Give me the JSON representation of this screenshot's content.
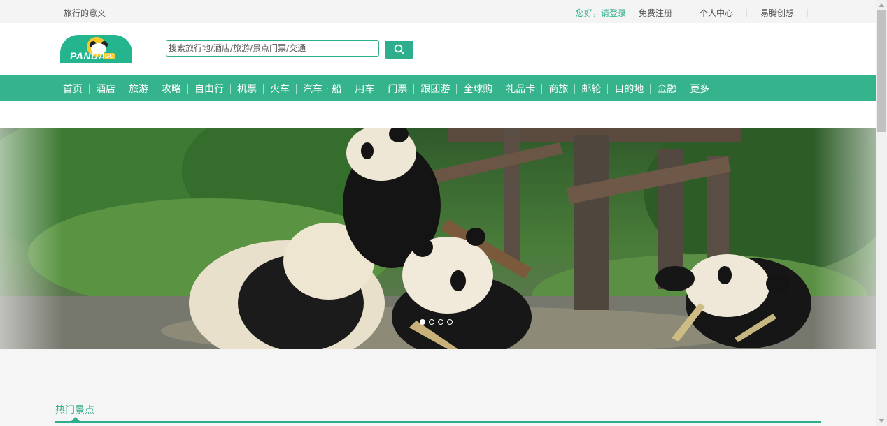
{
  "topbar": {
    "slogan": "旅行的意义",
    "login": "您好，请登录",
    "register": "免费注册",
    "personal_center": "个人中心",
    "yiteng": "易腾创想"
  },
  "logo": {
    "text": "PANDA",
    "badge": "GO"
  },
  "search": {
    "placeholder": "搜索旅行地/酒店/旅游/景点门票/交通",
    "button_icon": "search-icon"
  },
  "nav": {
    "items": [
      "首页",
      "酒店",
      "旅游",
      "攻略",
      "自由行",
      "机票",
      "火车",
      "汽车 · 船",
      "用车",
      "门票",
      "跟团游",
      "全球购",
      "礼品卡",
      "商旅",
      "邮轮",
      "目的地",
      "金融",
      "更多"
    ]
  },
  "banner": {
    "slides": 4,
    "active_slide": 1
  },
  "section": {
    "title": "热门景点"
  },
  "colors": {
    "brand": "#35b38d",
    "accent": "#2fae8e"
  }
}
